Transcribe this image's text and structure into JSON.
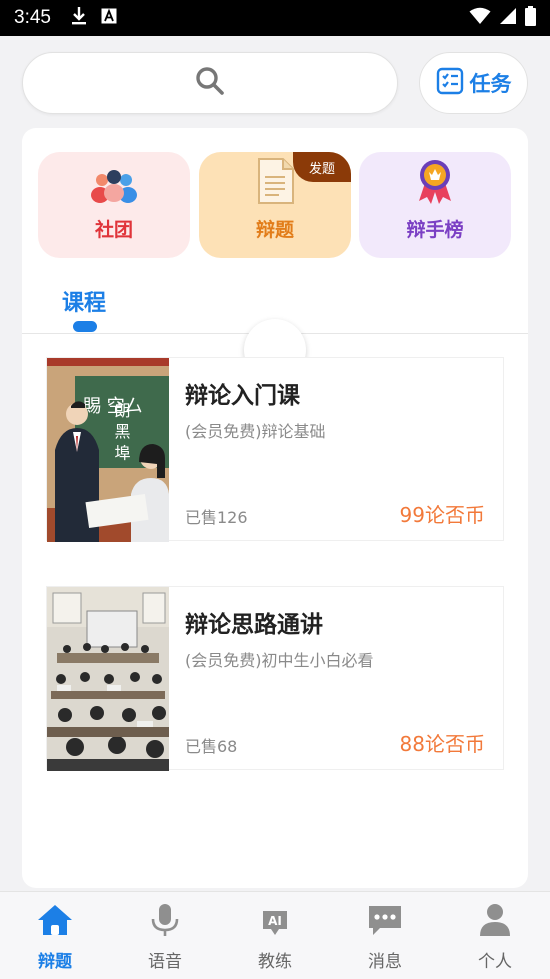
{
  "status_bar": {
    "time": "3:45",
    "download_icon": "download-icon",
    "a_icon": "text-a-icon",
    "wifi_icon": "wifi-icon",
    "signal_icon": "signal-icon",
    "battery_icon": "battery-icon"
  },
  "search": {
    "icon": "search-icon"
  },
  "task_button": {
    "label": "任务",
    "icon": "task-list-icon"
  },
  "tiles": [
    {
      "label": "社团",
      "icon": "club-people-icon"
    },
    {
      "label": "辩题",
      "icon": "document-icon",
      "badge": "发题"
    },
    {
      "label": "辩手榜",
      "icon": "medal-icon"
    }
  ],
  "tabs": {
    "active": "课程"
  },
  "courses": [
    {
      "title": "辩论入门课",
      "description": "(会员免费)辩论基础",
      "sold": "已售126",
      "price": "99论否币",
      "thumbnail_text": [
        "賜 空厶",
        "朗 黑 埠"
      ]
    },
    {
      "title": "辩论思路通讲",
      "description": "(会员免费)初中生小白必看",
      "sold": "已售68",
      "price": "88论否币"
    }
  ],
  "bottom_nav": [
    {
      "label": "辩题",
      "icon": "home-icon",
      "active": true
    },
    {
      "label": "语音",
      "icon": "microphone-icon"
    },
    {
      "label": "教练",
      "icon": "ai-coach-icon"
    },
    {
      "label": "消息",
      "icon": "chat-bubble-icon"
    },
    {
      "label": "个人",
      "icon": "person-icon"
    }
  ],
  "colors": {
    "accent": "#1c7fe6",
    "price": "#f2793a",
    "club": "#e0343a",
    "topic": "#e27d1a",
    "rank": "#7b3fc4"
  }
}
